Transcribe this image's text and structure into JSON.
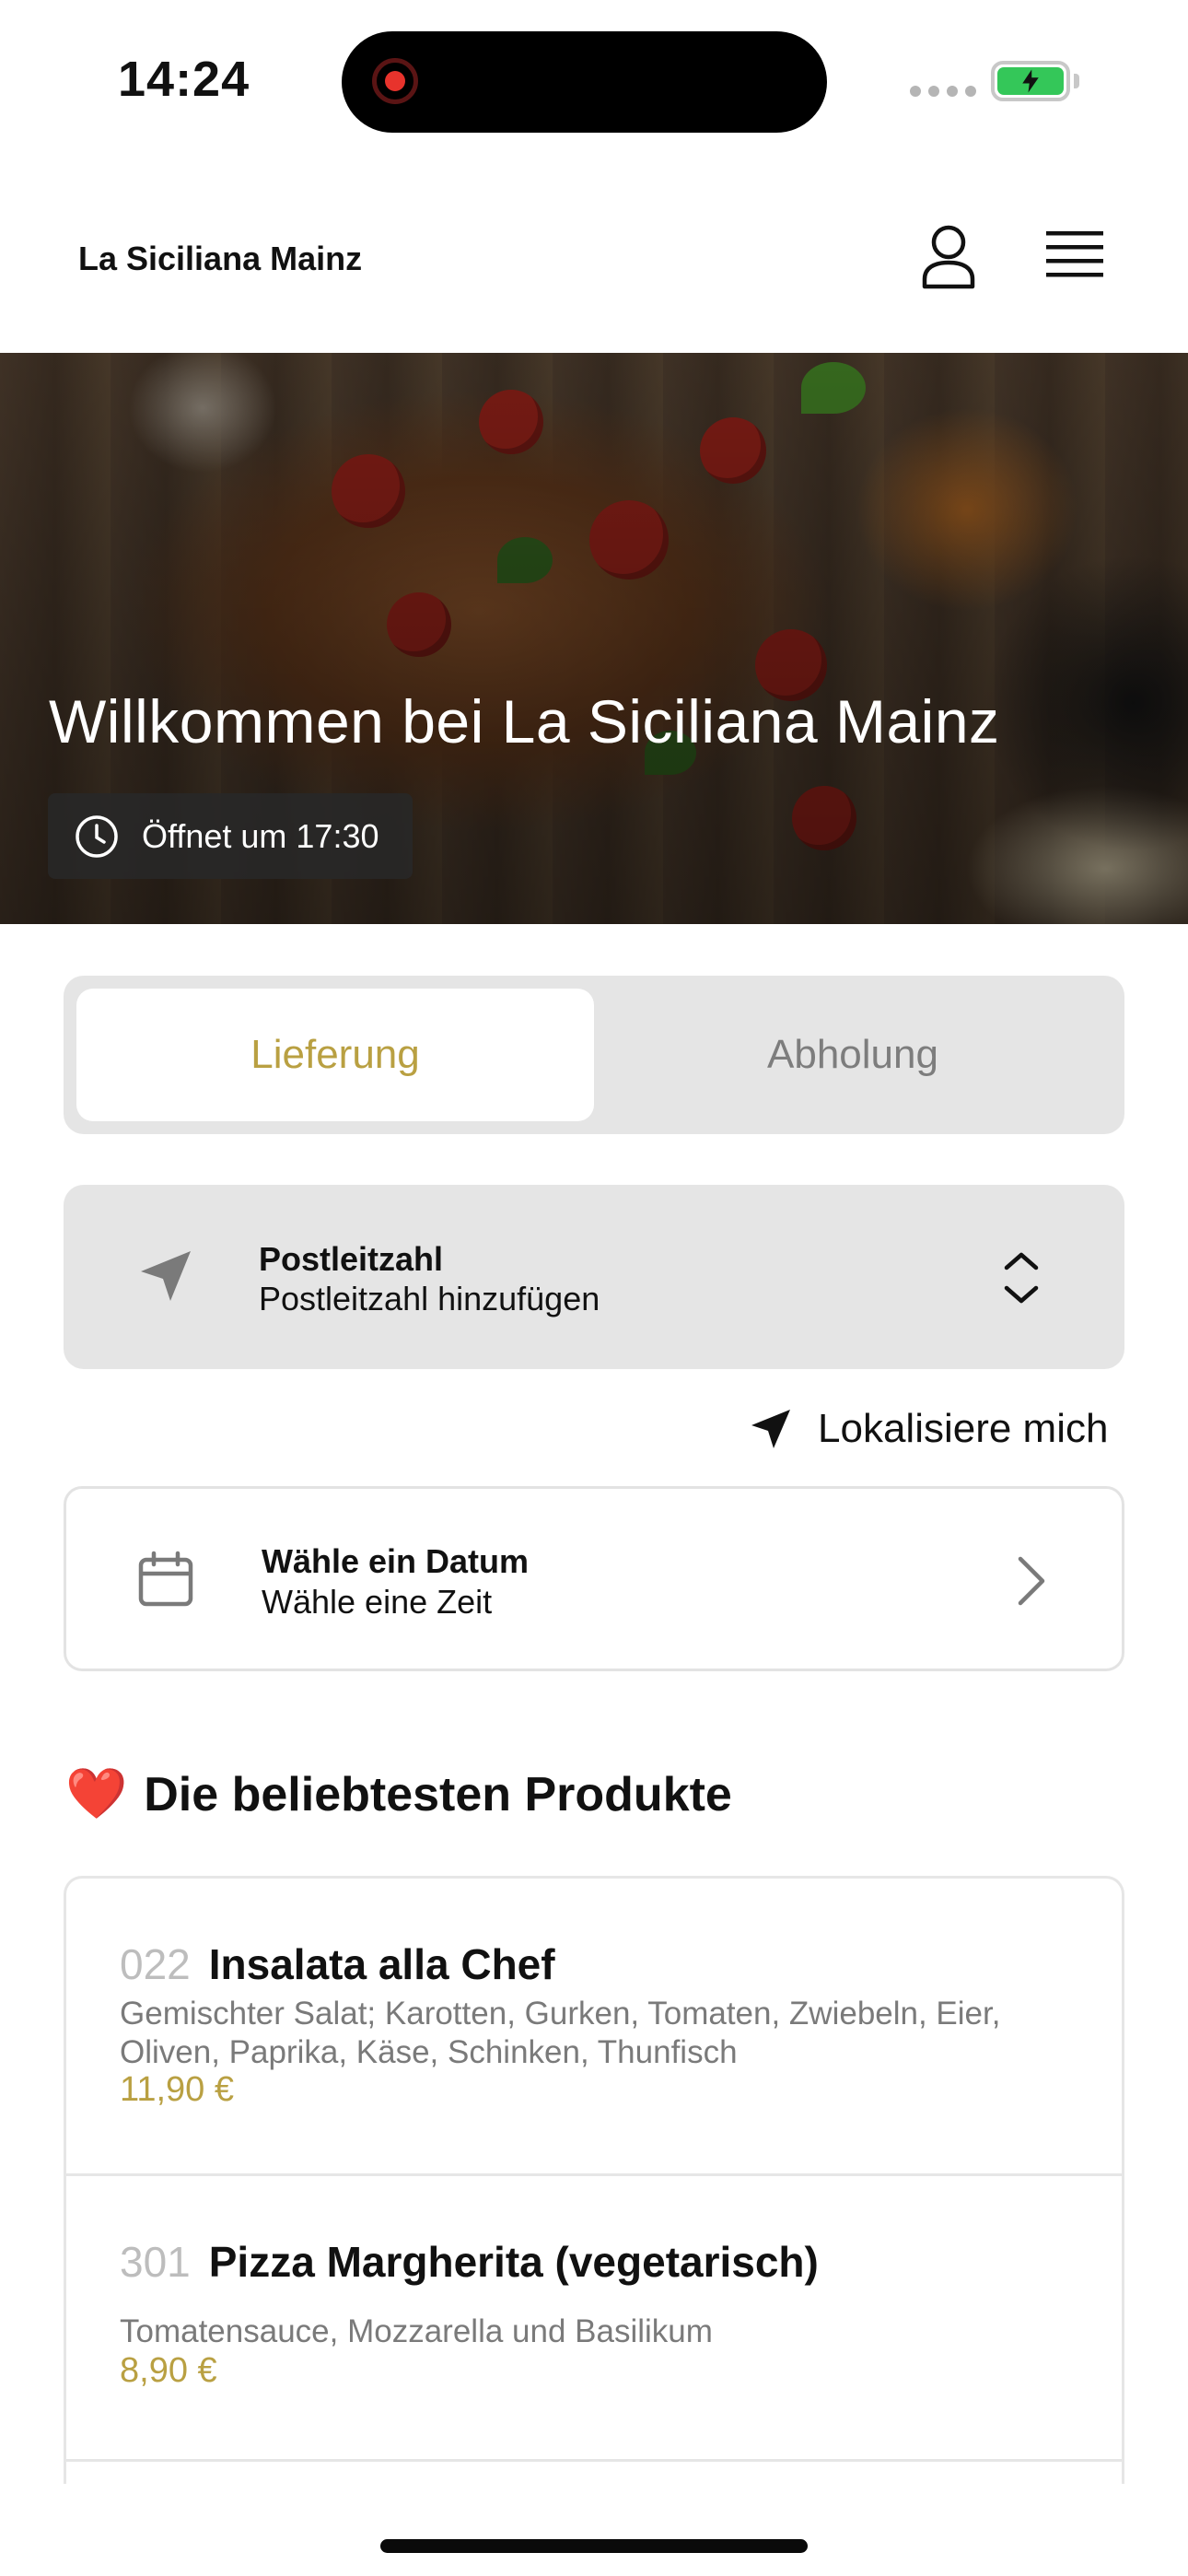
{
  "status_bar": {
    "time": "14:24"
  },
  "header": {
    "brand": "La Siciliana Mainz",
    "account_icon": "person-icon",
    "menu_icon": "hamburger-icon"
  },
  "hero": {
    "title": "Willkommen bei La Siciliana Mainz",
    "opening_label": "Öffnet um 17:30",
    "opening_icon": "clock-icon"
  },
  "order_mode": {
    "options": [
      "Lieferung",
      "Abholung"
    ],
    "selected": "Lieferung"
  },
  "postcode": {
    "icon": "location-arrow-icon",
    "title": "Postleitzahl",
    "subtitle": "Postleitzahl hinzufügen"
  },
  "locate_me": {
    "icon": "location-arrow-icon",
    "label": "Lokalisiere mich"
  },
  "date_picker": {
    "icon": "calendar-icon",
    "title": "Wähle ein Datum",
    "subtitle": "Wähle eine Zeit"
  },
  "popular": {
    "emoji": "❤️",
    "title": "Die beliebtesten Produkte",
    "products": [
      {
        "number": "022",
        "name": "Insalata alla Chef",
        "description": "Gemischter Salat; Karotten, Gurken, Tomaten, Zwiebeln, Eier, Oliven, Paprika, Käse, Schinken, Thunfisch",
        "price": "11,90 €"
      },
      {
        "number": "301",
        "name": "Pizza Margherita (vegetarisch)",
        "description": "Tomatensauce, Mozzarella und Basilikum",
        "price": "8,90 €"
      }
    ]
  },
  "colors": {
    "accent": "#b9a042",
    "panel": "#e5e5e5"
  }
}
